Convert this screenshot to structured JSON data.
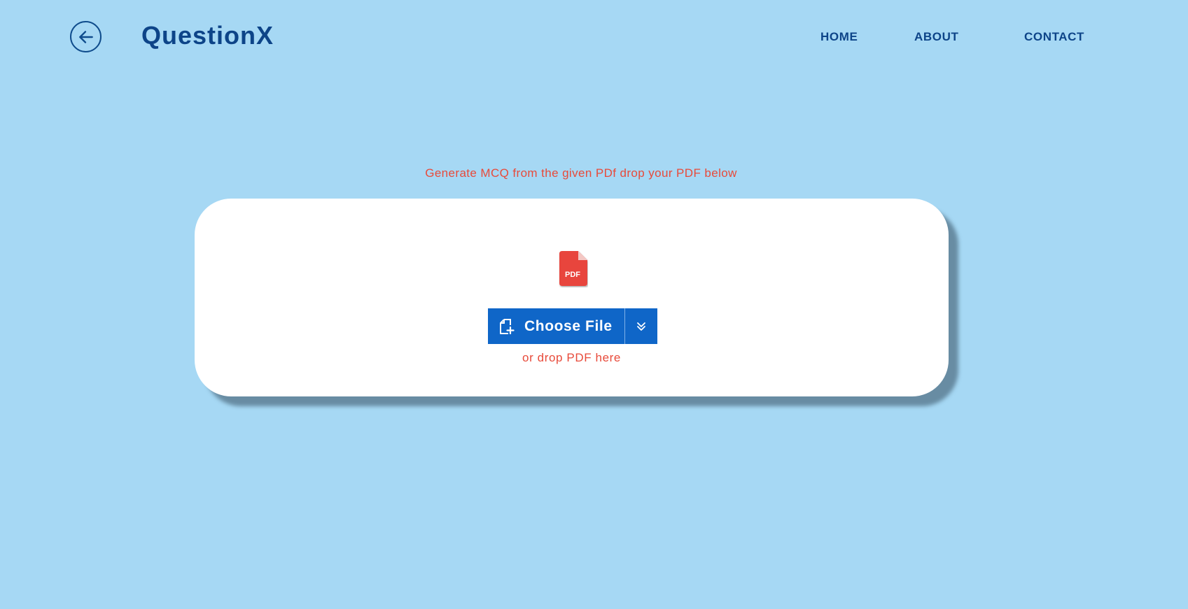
{
  "header": {
    "back_icon": "arrow-left-circle-icon",
    "brand": "QuestionX",
    "nav": [
      {
        "label": "HOME"
      },
      {
        "label": "ABOUT"
      },
      {
        "label": "CONTACT"
      }
    ]
  },
  "main": {
    "prompt": "Generate MCQ from the given PDf drop your PDF below",
    "upload": {
      "file_icon": "pdf-file-icon",
      "file_icon_text": "PDF",
      "button_icon": "add-file-icon",
      "button_label": "Choose File",
      "more_icon": "double-chevron-down-icon",
      "drop_hint": "or drop PDF here"
    }
  },
  "colors": {
    "background": "#a6d8f4",
    "brand_text": "#0d4488",
    "accent_red": "#e84a3a",
    "button_blue": "#0f66c8",
    "card": "#ffffff"
  }
}
